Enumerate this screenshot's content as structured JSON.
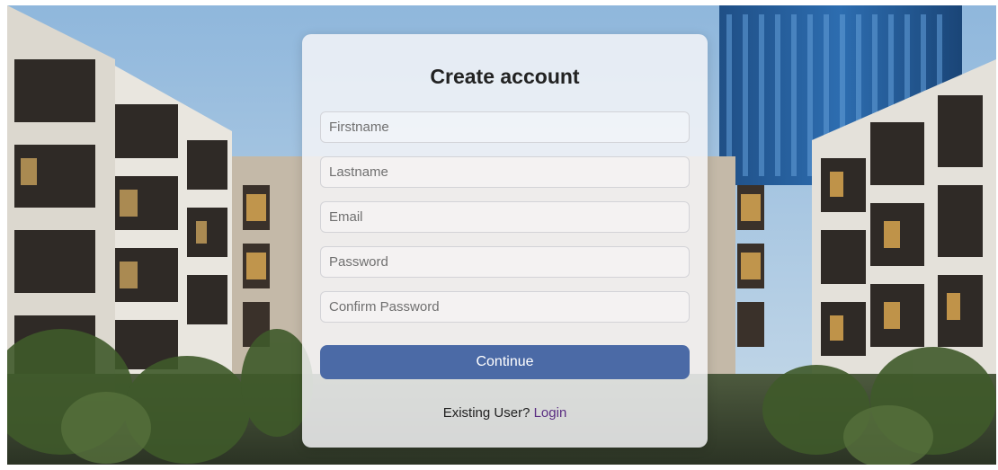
{
  "form": {
    "title": "Create account",
    "firstname_placeholder": "Firstname",
    "lastname_placeholder": "Lastname",
    "email_placeholder": "Email",
    "password_placeholder": "Password",
    "confirm_password_placeholder": "Confirm Password",
    "continue_label": "Continue",
    "existing_user_text": "Existing User?",
    "login_label": "Login"
  },
  "colors": {
    "button": "#4b6aa6",
    "login_link": "#5a2d82"
  }
}
